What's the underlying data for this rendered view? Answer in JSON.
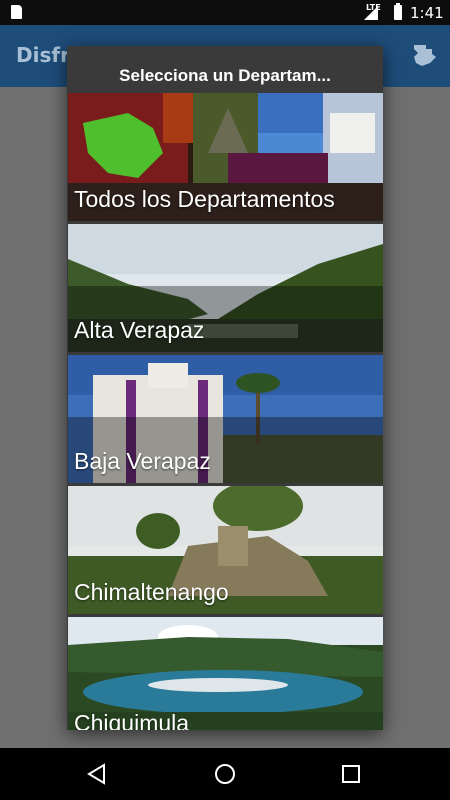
{
  "status_bar": {
    "time": "1:41",
    "network": "LTE"
  },
  "app_bar": {
    "title": "Disfruta"
  },
  "dialog": {
    "title": "Selecciona un Departam...",
    "items": [
      {
        "label": "Todos los Departamentos"
      },
      {
        "label": "Alta Verapaz"
      },
      {
        "label": "Baja Verapaz"
      },
      {
        "label": "Chimaltenango"
      },
      {
        "label": "Chiquimula"
      }
    ]
  },
  "colors": {
    "app_bar": "#1e4d7a",
    "overlay": "#707070",
    "dialog": "#3a3a3a"
  }
}
